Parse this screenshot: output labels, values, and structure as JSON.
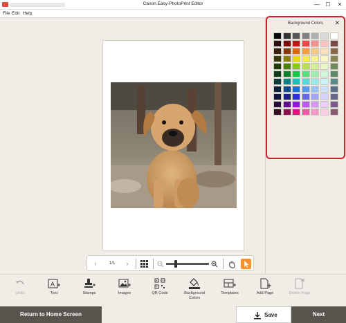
{
  "window": {
    "title": "Canon Easy-PhotoPrint Editor",
    "minimize": "—",
    "maximize": "☐",
    "close": "✕"
  },
  "menu": [
    "File",
    "Edit",
    "Help"
  ],
  "zoombar": {
    "page_counter": "1/1",
    "zoom_level": 0.2
  },
  "panel": {
    "title": "Background Colors",
    "close": "✕",
    "swatches": [
      "#0a0a0a",
      "#333333",
      "#555555",
      "#808080",
      "#b0b0b0",
      "#d9d9d9",
      "#ffffff",
      "#2a0e0e",
      "#7a0c0c",
      "#c81414",
      "#e84848",
      "#f49090",
      "#f9c4c4",
      "#7a4a4a",
      "#3a200c",
      "#8a3a08",
      "#d86a10",
      "#f0a040",
      "#f6c882",
      "#f9e1bb",
      "#8a6a4a",
      "#3a3a08",
      "#8a8208",
      "#e8d810",
      "#f2ec50",
      "#f6f292",
      "#fbf8c8",
      "#8a8658",
      "#203a08",
      "#4a8208",
      "#8ac810",
      "#b8e050",
      "#d2ee92",
      "#e8f6c8",
      "#6e8a58",
      "#0c3a14",
      "#0e8228",
      "#18c844",
      "#58e078",
      "#9aeeae",
      "#cff6d8",
      "#5a8a66",
      "#0c3a3a",
      "#0e8282",
      "#18c0c0",
      "#58dada",
      "#9aeaea",
      "#cdf4f4",
      "#5a8a8a",
      "#0c1e3a",
      "#0e4a8a",
      "#1870d8",
      "#5898ec",
      "#9ac0f4",
      "#cde0fa",
      "#5a6e8a",
      "#14143a",
      "#20208a",
      "#3030d8",
      "#6868ec",
      "#a4a4f4",
      "#d2d2fa",
      "#66668a",
      "#2a0c3a",
      "#5e0e8a",
      "#9018d8",
      "#b858ec",
      "#d69af4",
      "#ebcdfa",
      "#7a5a8a",
      "#3a0c24",
      "#8a0e50",
      "#d8187c",
      "#ec58a4",
      "#f49ac8",
      "#facde4",
      "#8a5a72"
    ]
  },
  "tools": [
    {
      "name": "undo",
      "label": "Undo",
      "disabled": true
    },
    {
      "name": "text",
      "label": "Text"
    },
    {
      "name": "stamps",
      "label": "Stamps"
    },
    {
      "name": "images",
      "label": "Images"
    },
    {
      "name": "qr-code",
      "label": "QR Code"
    },
    {
      "name": "background-colors",
      "label": "Background\nColors"
    },
    {
      "name": "templates",
      "label": "Templates"
    },
    {
      "name": "add-page",
      "label": "Add Page"
    },
    {
      "name": "delete-page",
      "label": "Delete Page",
      "disabled": true
    }
  ],
  "footer": {
    "home": "Return to Home Screen",
    "save": "Save",
    "next": "Next"
  }
}
